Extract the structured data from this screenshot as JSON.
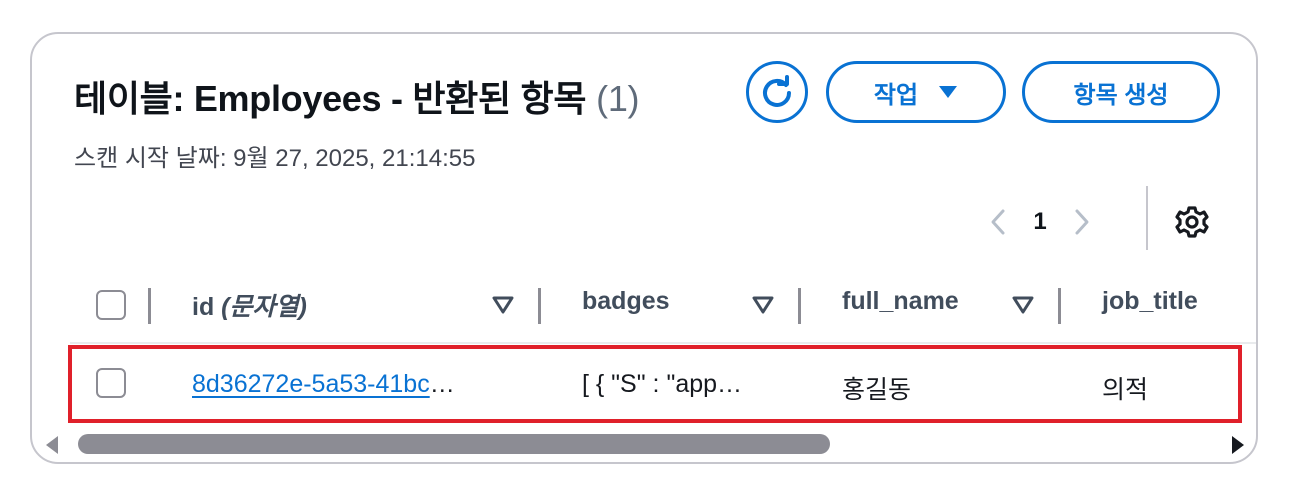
{
  "header": {
    "title": "테이블: Employees - 반환된 항목",
    "count": "(1)",
    "subtitle": "스캔 시작 날짜: 9월 27, 2025, 21:14:55",
    "actions_label": "작업",
    "create_label": "항목 생성"
  },
  "pagination": {
    "current_page": "1"
  },
  "table": {
    "columns": [
      {
        "label": "id",
        "type_hint": "(문자열)"
      },
      {
        "label": "badges"
      },
      {
        "label": "full_name"
      },
      {
        "label": "job_title"
      }
    ],
    "rows": [
      {
        "id_visible": "8d36272e-5a53-41bc",
        "id_ellipsis": "…",
        "badges": "[ { \"S\" : \"app…",
        "full_name": "홍길동",
        "job_title": "의적"
      }
    ]
  },
  "colors": {
    "accent": "#0972d3",
    "highlight_border": "#e0202a",
    "muted": "#8c8c94"
  },
  "icons": [
    "refresh-icon",
    "caret-down-icon",
    "chevron-left-icon",
    "chevron-right-icon",
    "gear-icon",
    "sort-icon",
    "scroll-left-icon",
    "scroll-right-icon"
  ]
}
